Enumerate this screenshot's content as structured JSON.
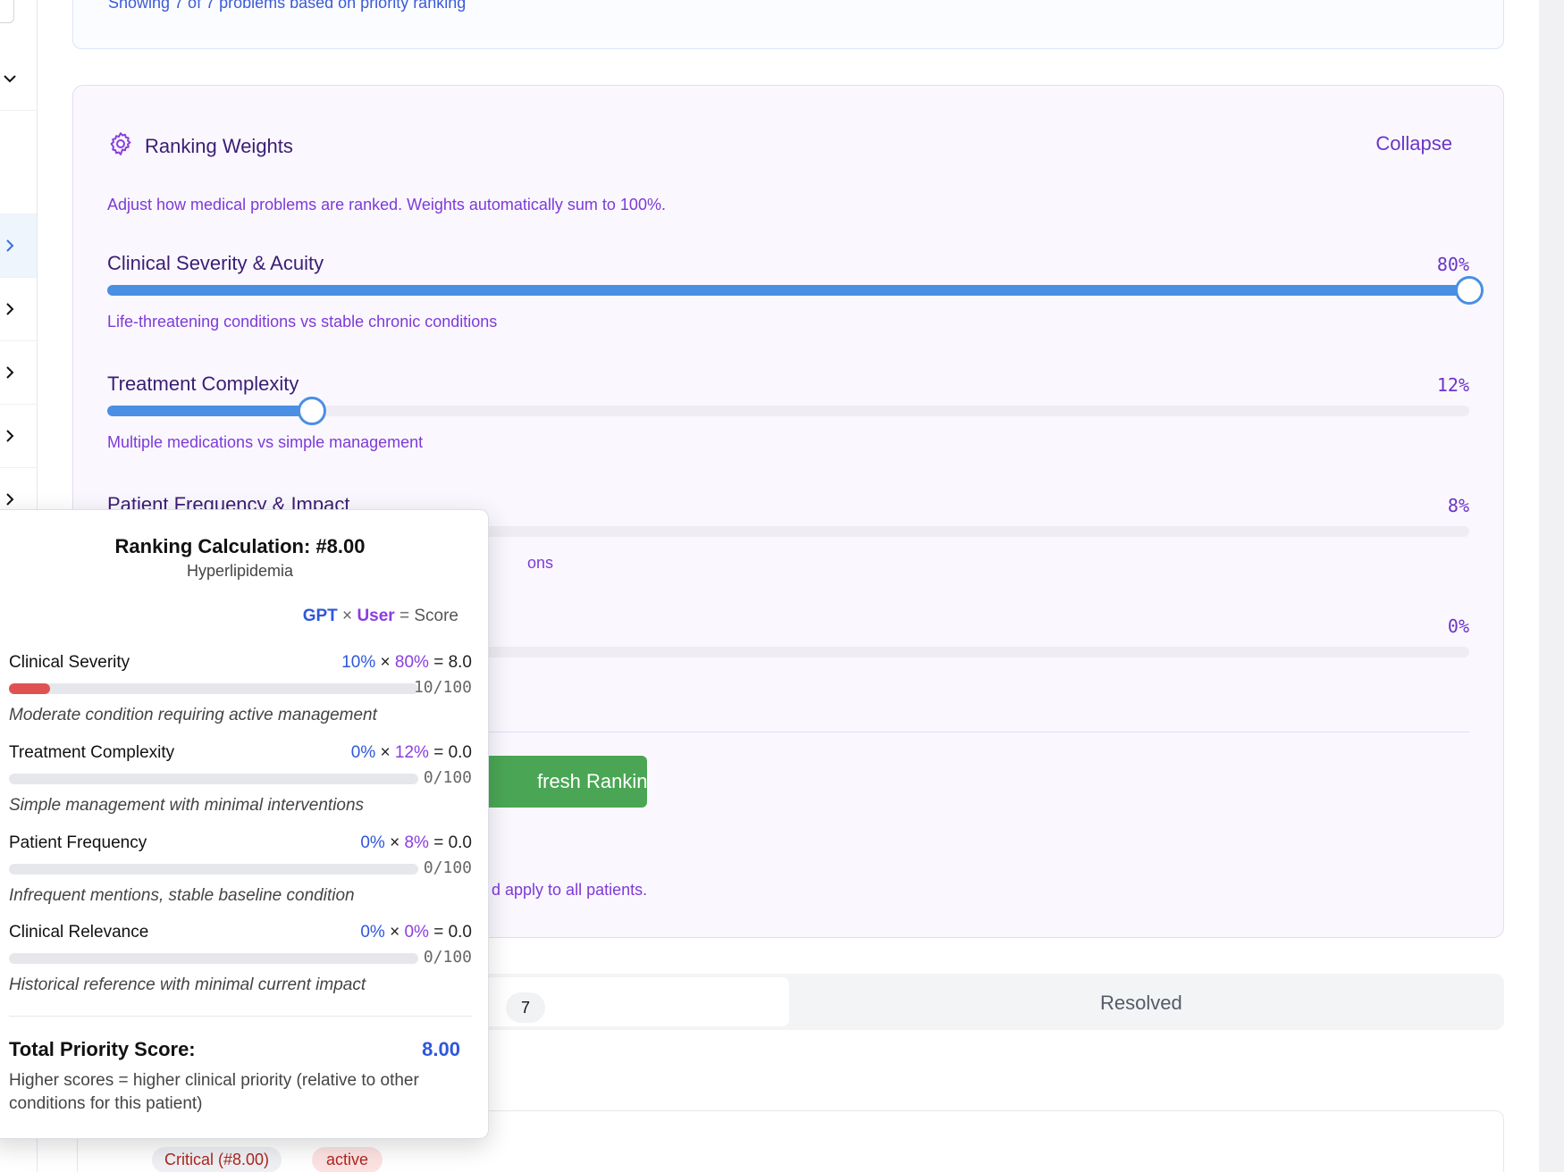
{
  "top_card": {
    "showing_text": "Showing 7 of 7 problems based on priority ranking"
  },
  "weights_panel": {
    "title": "Ranking Weights",
    "collapse_label": "Collapse",
    "description": "Adjust how medical problems are ranked. Weights automatically sum to 100%.",
    "sliders": [
      {
        "label": "Clinical Severity & Acuity",
        "value_text": "80%",
        "value": 80,
        "help": "Life-threatening conditions vs stable chronic conditions"
      },
      {
        "label": "Treatment Complexity",
        "value_text": "12%",
        "value": 12,
        "help": "Multiple medications vs simple management"
      },
      {
        "label": "Patient Frequency & Impact",
        "value_text": "8%",
        "value": 8,
        "help_partial": "ons"
      },
      {
        "value_text": "0%",
        "value": 0
      }
    ],
    "refresh_button_partial": "fresh Rankings",
    "apply_note_partial": "d apply to all patients.",
    "accent_color": "#4a8fe3"
  },
  "tabs": {
    "active_count": "7",
    "resolved_label": "Resolved"
  },
  "problem_card": {
    "badge_priority": "Critical (#8.00)",
    "badge_status": "active"
  },
  "popover": {
    "title": "Ranking Calculation: #8.00",
    "subtitle": "Hyperlipidemia",
    "legend": {
      "gpt": "GPT",
      "times": "×",
      "user": "User",
      "equals": "=",
      "score": "Score"
    },
    "metrics": [
      {
        "name": "Clinical Severity",
        "gpt": "10%",
        "user": "80%",
        "result": "= 8.0",
        "out_of": "10/100",
        "fill": 10,
        "desc": "Moderate condition requiring active management"
      },
      {
        "name": "Treatment Complexity",
        "gpt": "0%",
        "user": "12%",
        "result": "= 0.0",
        "out_of": "0/100",
        "fill": 0,
        "desc": "Simple management with minimal interventions"
      },
      {
        "name": "Patient Frequency",
        "gpt": "0%",
        "user": "8%",
        "result": "= 0.0",
        "out_of": "0/100",
        "fill": 0,
        "desc": "Infrequent mentions, stable baseline condition"
      },
      {
        "name": "Clinical Relevance",
        "gpt": "0%",
        "user": "0%",
        "result": "= 0.0",
        "out_of": "0/100",
        "fill": 0,
        "desc": "Historical reference with minimal current impact"
      }
    ],
    "times_sign": "×",
    "total_label": "Total Priority Score:",
    "total_value": "8.00",
    "total_note": "Higher scores = higher clinical priority (relative to other conditions for this patient)"
  },
  "icons": {
    "settings": "gear-icon",
    "sidebar_chevrons": [
      "chevron-down-icon",
      "chevron-right-icon"
    ]
  },
  "colors": {
    "severity_bar": "#e05252",
    "gpt": "#2f57dc",
    "user": "#8a3de0",
    "refresh_button": "#4aa654"
  }
}
